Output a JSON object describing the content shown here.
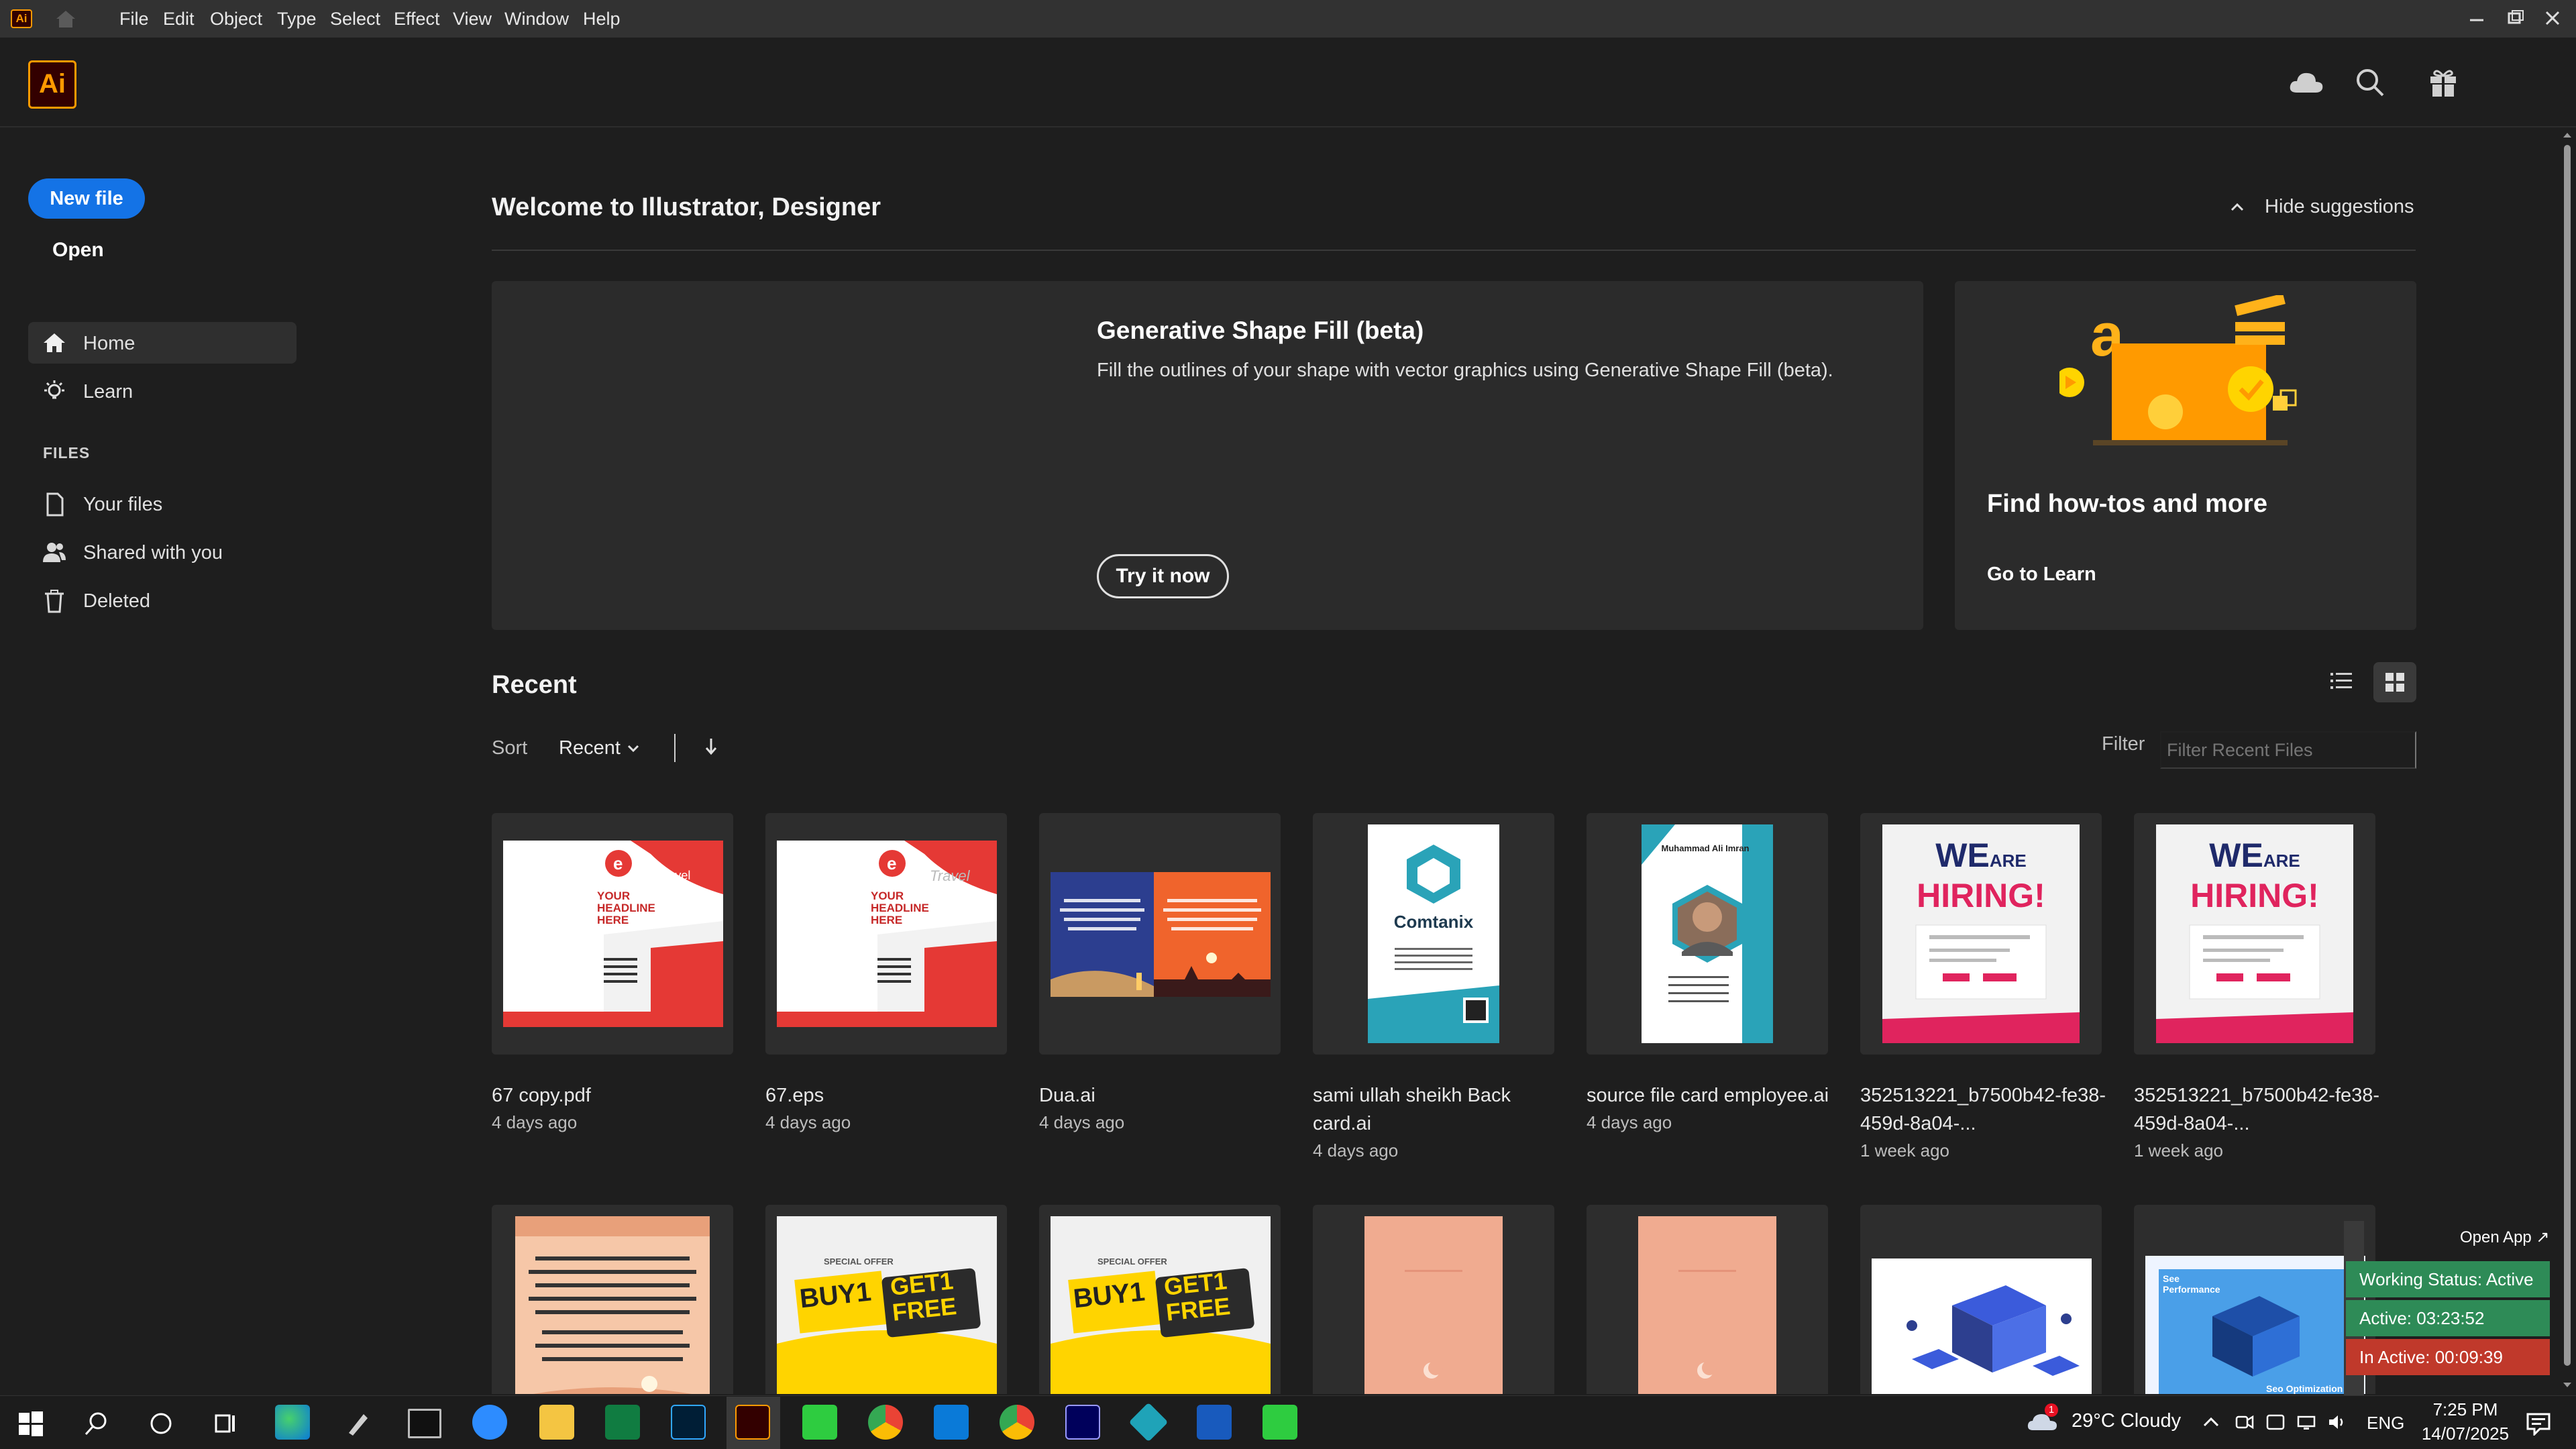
{
  "menubar": {
    "app_badge": "Ai",
    "items": [
      "File",
      "Edit",
      "Object",
      "Type",
      "Select",
      "Effect",
      "View",
      "Window",
      "Help"
    ]
  },
  "header": {
    "logo": "Ai",
    "icons": [
      "cloud-icon",
      "search-icon",
      "gift-icon"
    ]
  },
  "sidebar": {
    "new_file": "New file",
    "open": "Open",
    "home": "Home",
    "learn": "Learn",
    "files_heading": "FILES",
    "your_files": "Your files",
    "shared": "Shared with you",
    "deleted": "Deleted"
  },
  "main": {
    "welcome": "Welcome to Illustrator, Designer",
    "hide_suggestions": "Hide suggestions",
    "promo": {
      "title": "Generative Shape Fill (beta)",
      "text": "Fill the outlines of your shape with vector graphics using Generative Shape Fill (beta).",
      "button": "Try it now"
    },
    "learn_card": {
      "title": "Find how-tos and more",
      "link": "Go to Learn"
    },
    "recent": "Recent",
    "sort_label": "Sort",
    "sort_value": "Recent",
    "filter_label": "Filter",
    "filter_placeholder": "Filter Recent Files",
    "files": [
      {
        "name": "67 copy.pdf",
        "date": "4 days ago"
      },
      {
        "name": "67.eps",
        "date": "4 days ago"
      },
      {
        "name": "Dua.ai",
        "date": "4 days ago"
      },
      {
        "name": "sami ullah sheikh Back card.ai",
        "date": "4 days ago"
      },
      {
        "name": "source file card employee.ai",
        "date": "4 days ago"
      },
      {
        "name": "352513221_b7500b42-fe38-459d-8a04-...",
        "date": "1 week ago"
      },
      {
        "name": "352513221_b7500b42-fe38-459d-8a04-...",
        "date": "1 week ago"
      }
    ],
    "thumb_text": {
      "headline": "YOUR HEADLINE HERE",
      "travel": "Travel",
      "brand": "Comtanix",
      "person": "Muhammad Ali Imran",
      "hiring1": "WE",
      "hiring2": "ARE",
      "hiring3": "HIRING!",
      "buy1": "BUY1",
      "get1": "GET1",
      "free": "FREE",
      "special": "SPECIAL OFFER",
      "see_perf": "See Performance",
      "see_opt": "Seo Optimization"
    }
  },
  "overlay": {
    "open_app": "Open App ↗",
    "working": "Working Status: Active",
    "active": "Active: 03:23:52",
    "inactive": "In Active: 00:09:39"
  },
  "taskbar": {
    "weather": "29°C  Cloudy",
    "lang": "ENG",
    "time": "7:25 PM",
    "date": "14/07/2025",
    "weather_badge": "1"
  },
  "colors": {
    "accent": "#1473e6",
    "ai_orange": "#ff9a00",
    "ai_bg": "#330000",
    "overlay_green": "#2e8b57",
    "overlay_red": "#c0392b"
  }
}
